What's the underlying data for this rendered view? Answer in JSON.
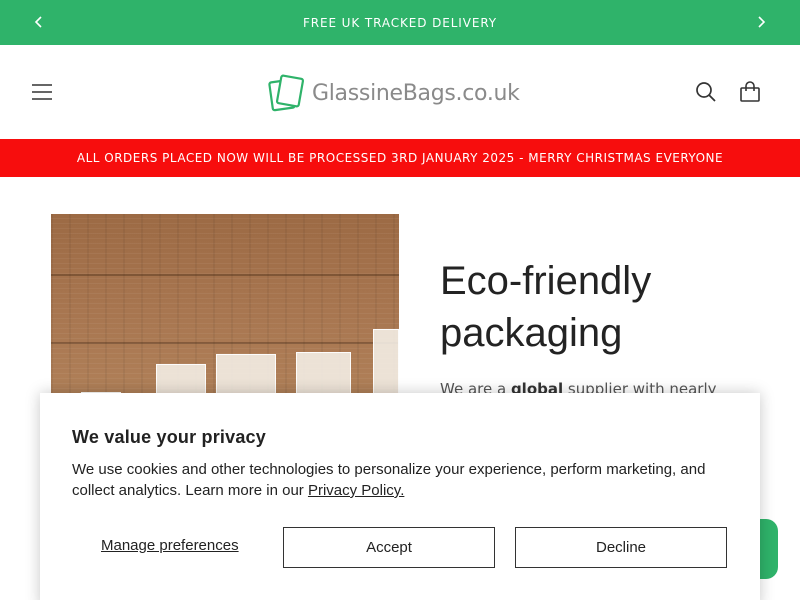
{
  "announcement": {
    "text": "FREE UK TRACKED DELIVERY"
  },
  "header": {
    "logo_text": "GlassineBags.co.uk"
  },
  "notice": {
    "text": "ALL ORDERS PLACED NOW WILL BE PROCESSED 3RD JANUARY 2025 - MERRY CHRISTMAS EVERYONE"
  },
  "hero": {
    "title_line1": "Eco-friendly",
    "title_line2": "packaging",
    "text_before": "We are a ",
    "text_bold": "global",
    "text_after": " supplier with nearly"
  },
  "cookie_banner": {
    "title": "We value your privacy",
    "body": "We use cookies and other technologies to personalize your experience, perform marketing, and collect analytics. Learn more in our ",
    "policy_link": "Privacy Policy.",
    "manage_label": "Manage preferences",
    "accept_label": "Accept",
    "decline_label": "Decline"
  },
  "icons": {
    "prev": "chevron-left-icon",
    "next": "chevron-right-icon",
    "menu": "hamburger-menu-icon",
    "search": "search-icon",
    "cart": "shopping-bag-icon",
    "logo": "glassine-bag-logo-icon"
  },
  "colors": {
    "announcement_bg": "#2fb36a",
    "notice_bg": "#f70d0d",
    "logo_green": "#2fb36a",
    "chat_bg": "#2fb36a"
  }
}
